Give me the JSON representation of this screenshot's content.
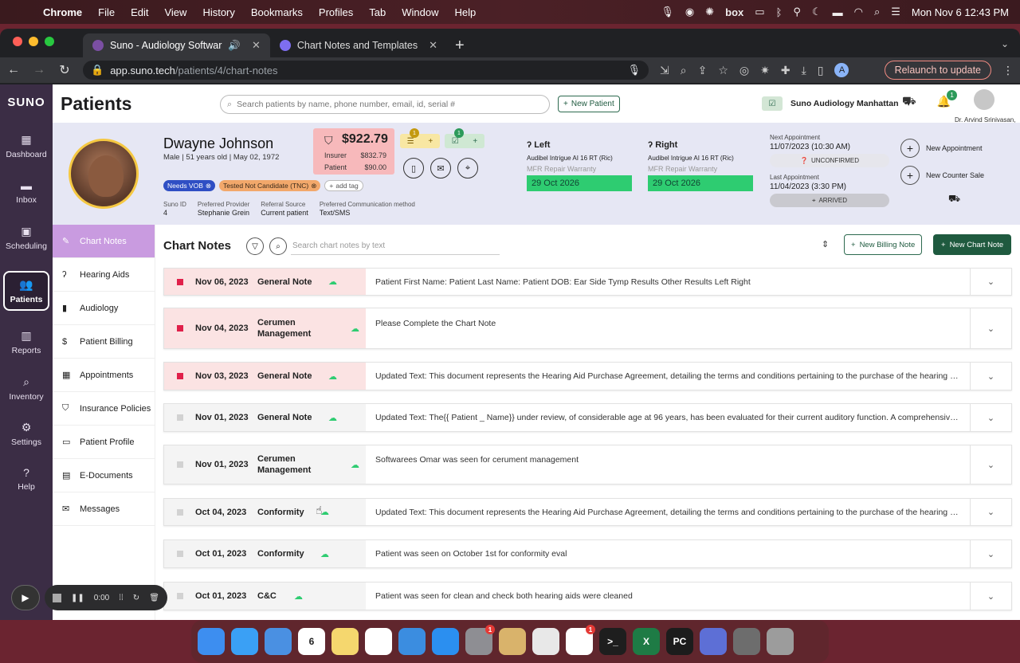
{
  "menubar": {
    "app": "Chrome",
    "items": [
      "File",
      "Edit",
      "View",
      "History",
      "Bookmarks",
      "Profiles",
      "Tab",
      "Window",
      "Help"
    ],
    "status_icons": [
      "mic-icon",
      "screen-record-icon",
      "gear-icon",
      "box-icon",
      "cast-icon",
      "bluetooth-icon",
      "network-icon",
      "moon-icon",
      "battery-icon",
      "wifi-icon",
      "spotlight-icon",
      "control-center-icon"
    ],
    "datetime": "Mon Nov 6  12:43 PM",
    "box_label": "box"
  },
  "browser": {
    "tabs": [
      {
        "title": "Suno - Audiology Softwar",
        "active": true
      },
      {
        "title": "Chart Notes and Templates",
        "active": false
      }
    ],
    "url_host": "app.suno.tech",
    "url_path": "/patients/4/chart-notes",
    "profile_initial": "A",
    "relaunch_label": "Relaunch to update"
  },
  "app": {
    "logo": "SUNO",
    "nav": [
      {
        "label": "Dashboard",
        "icon": "dashboard-icon"
      },
      {
        "label": "Inbox",
        "icon": "inbox-icon"
      },
      {
        "label": "Scheduling",
        "icon": "calendar-icon"
      },
      {
        "label": "Patients",
        "icon": "patients-icon",
        "active": true
      },
      {
        "label": "Reports",
        "icon": "reports-icon"
      },
      {
        "label": "Inventory",
        "icon": "inventory-icon"
      },
      {
        "label": "Settings",
        "icon": "settings-icon"
      },
      {
        "label": "Help",
        "icon": "help-icon"
      }
    ],
    "page_title": "Patients",
    "search_placeholder": "Search patients by name, phone number, email, id, serial #",
    "new_patient_label": "New Patient",
    "clinic_name": "Suno Audiology Manhattan",
    "notification_count": "1",
    "user_name": "Dr. Arvind Srinivasan,"
  },
  "patient": {
    "name": "Dwayne Johnson",
    "meta": "Male | 51 years old | May 02, 1972",
    "tags": [
      "Needs VOB",
      "Tested Not Candidate (TNC)"
    ],
    "add_tag": "add tag",
    "info": [
      {
        "label": "Suno ID",
        "value": "4"
      },
      {
        "label": "Preferred Provider",
        "value": "Stephanie Grein"
      },
      {
        "label": "Referral Source",
        "value": "Current patient"
      },
      {
        "label": "Preferred Communication method",
        "value": "Text/SMS"
      }
    ],
    "balance": {
      "total": "$922.79",
      "insurer_label": "Insurer",
      "insurer": "$832.79",
      "patient_label": "Patient",
      "patient": "$90.00"
    },
    "badge_counts": [
      "1",
      "1"
    ],
    "left": {
      "side": "Left",
      "model": "Audibel Intrigue AI 16 RT (Ric)",
      "warranty": "MFR Repair Warranty",
      "date": "29 Oct 2026"
    },
    "right": {
      "side": "Right",
      "model": "Audibel Intrigue AI 16 RT (Ric)",
      "warranty": "MFR Repair Warranty",
      "date": "29 Oct 2026"
    },
    "next_appt_label": "Next Appointment",
    "next_appt": "11/07/2023 (10:30 AM)",
    "next_status": "UNCONFIRMED",
    "last_appt_label": "Last Appointment",
    "last_appt": "11/04/2023 (3:30 PM)",
    "last_status": "ARRIVED",
    "new_appointment": "New Appointment",
    "new_counter_sale": "New Counter Sale"
  },
  "subnav": [
    {
      "label": "Chart Notes",
      "icon": "chart-notes-icon",
      "active": true
    },
    {
      "label": "Hearing Aids",
      "icon": "hearing-aid-icon"
    },
    {
      "label": "Audiology",
      "icon": "audiology-icon"
    },
    {
      "label": "Patient Billing",
      "icon": "billing-icon"
    },
    {
      "label": "Appointments",
      "icon": "appointments-icon"
    },
    {
      "label": "Insurance Policies",
      "icon": "shield-icon"
    },
    {
      "label": "Patient Profile",
      "icon": "profile-icon"
    },
    {
      "label": "E-Documents",
      "icon": "document-icon"
    },
    {
      "label": "Messages",
      "icon": "messages-icon"
    }
  ],
  "chart_notes": {
    "title": "Chart Notes",
    "search_placeholder": "Search chart notes by text",
    "new_billing_note": "New Billing Note",
    "new_chart_note": "New Chart Note",
    "rows": [
      {
        "date": "Nov 06, 2023",
        "type": "General Note",
        "status": "red",
        "text": "Patient First Name: Patient Last Name: Patient DOB: Ear Side Tymp Results Other Results Left Right"
      },
      {
        "date": "Nov 04, 2023",
        "type": "Cerumen Management",
        "status": "red",
        "text": "Please Complete the Chart Note"
      },
      {
        "date": "Nov 03, 2023",
        "type": "General Note",
        "status": "red",
        "text": "Updated Text: This document represents the Hearing Aid Purchase Agreement, detailing the terms and conditions pertaining to the purchase of the hearing aid d..."
      },
      {
        "date": "Nov 01, 2023",
        "type": "General Note",
        "status": "gray",
        "text": "Updated Text: The{{ Patient _ Name}} under review, of considerable age at 96 years, has been evaluated for their current auditory function. A comprehensive hear..."
      },
      {
        "date": "Nov 01, 2023",
        "type": "Cerumen Management",
        "status": "gray",
        "text": "Softwarees Omar was seen for cerument management"
      },
      {
        "date": "Oct 04, 2023",
        "type": "Conformity",
        "status": "gray",
        "text": "Updated Text: This document represents the Hearing Aid Purchase Agreement, detailing the terms and conditions pertaining to the purchase of the hearing aid d..."
      },
      {
        "date": "Oct 01, 2023",
        "type": "Conformity",
        "status": "gray",
        "text": "Patient was seen on October 1st for conformity eval"
      },
      {
        "date": "Oct 01, 2023",
        "type": "C&C",
        "status": "gray",
        "text": "Patient was seen for clean and check both hearing aids were cleaned"
      }
    ]
  },
  "recorder": {
    "time": "0:00"
  },
  "dock": {
    "apps": [
      {
        "name": "finder",
        "color": "#3d8ef0",
        "label": ""
      },
      {
        "name": "safari",
        "color": "#3aa0f5",
        "label": ""
      },
      {
        "name": "mail",
        "color": "#4a90e2",
        "label": ""
      },
      {
        "name": "calendar",
        "color": "#ffffff",
        "label": "6"
      },
      {
        "name": "notes",
        "color": "#f5d76e",
        "label": ""
      },
      {
        "name": "freeform",
        "color": "#ffffff",
        "label": ""
      },
      {
        "name": "keynote",
        "color": "#3b8de0",
        "label": ""
      },
      {
        "name": "app-store",
        "color": "#2b8ff0",
        "label": ""
      },
      {
        "name": "system-settings",
        "color": "#8e8e93",
        "label": "",
        "badge": "1"
      },
      {
        "name": "archive",
        "color": "#d9b36b",
        "label": ""
      },
      {
        "name": "chrome",
        "color": "#e8e8e8",
        "label": ""
      },
      {
        "name": "slack",
        "color": "#ffffff",
        "label": "",
        "badge": "1"
      },
      {
        "name": "terminal",
        "color": "#1e1e1e",
        "label": ">_"
      },
      {
        "name": "excel",
        "color": "#1e7b45",
        "label": "X"
      },
      {
        "name": "pycharm",
        "color": "#1c1c1c",
        "label": "PC"
      },
      {
        "name": "vpn",
        "color": "#5d6fd6",
        "label": ""
      },
      {
        "name": "preview",
        "color": "#6d6d6d",
        "label": ""
      },
      {
        "name": "trash",
        "color": "#9c9c9c",
        "label": ""
      }
    ]
  }
}
